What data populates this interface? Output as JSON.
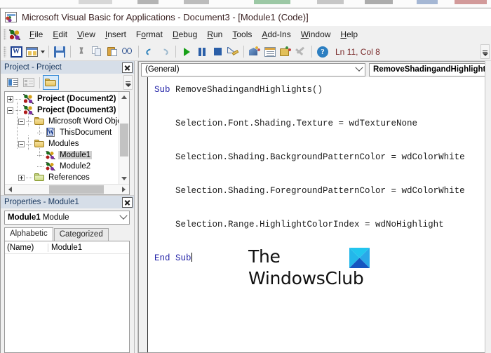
{
  "window": {
    "title": "Microsoft Visual Basic for Applications - Document3 - [Module1 (Code)]",
    "title_icon": "vba-document-icon"
  },
  "menu": {
    "app_icon": "vba-icon",
    "items": [
      {
        "label": "File",
        "accel": "F"
      },
      {
        "label": "Edit",
        "accel": "E"
      },
      {
        "label": "View",
        "accel": "V"
      },
      {
        "label": "Insert",
        "accel": "I"
      },
      {
        "label": "Format",
        "accel": "o"
      },
      {
        "label": "Debug",
        "accel": "D"
      },
      {
        "label": "Run",
        "accel": "R"
      },
      {
        "label": "Tools",
        "accel": "T"
      },
      {
        "label": "Add-Ins",
        "accel": "A"
      },
      {
        "label": "Window",
        "accel": "W"
      },
      {
        "label": "Help",
        "accel": "H"
      }
    ]
  },
  "toolbar": {
    "buttons": [
      {
        "name": "view-word-button",
        "icon": "word-icon"
      },
      {
        "name": "insert-userform-button",
        "icon": "userform-icon"
      },
      {
        "name": "insert-dropdown-button",
        "icon": "chevron-down-icon"
      },
      {
        "name": "save-button",
        "icon": "save-icon"
      },
      {
        "name": "cut-button",
        "icon": "scissors-icon"
      },
      {
        "name": "copy-button",
        "icon": "copy-icon"
      },
      {
        "name": "paste-button",
        "icon": "paste-icon"
      },
      {
        "name": "find-button",
        "icon": "binoculars-icon"
      },
      {
        "name": "undo-button",
        "icon": "undo-arrow-icon"
      },
      {
        "name": "redo-button",
        "icon": "redo-arrow-icon"
      },
      {
        "name": "run-button",
        "icon": "play-triangle-icon"
      },
      {
        "name": "break-button",
        "icon": "pause-icon"
      },
      {
        "name": "reset-button",
        "icon": "stop-square-icon"
      },
      {
        "name": "design-mode-button",
        "icon": "ruler-pencil-icon"
      },
      {
        "name": "project-explorer-button",
        "icon": "project-explorer-icon"
      },
      {
        "name": "properties-window-button",
        "icon": "properties-window-icon"
      },
      {
        "name": "object-browser-button",
        "icon": "object-browser-icon"
      },
      {
        "name": "toolbox-button",
        "icon": "toolbox-icon"
      },
      {
        "name": "help-button",
        "icon": "question-help-icon"
      }
    ],
    "position_indicator": "Ln 11, Col 8",
    "overflow_icon": "toolbar-overflow-icon",
    "word_glyph": "W",
    "help_glyph": "?"
  },
  "project_explorer": {
    "title": "Project - Project",
    "close_icon": "close-icon",
    "toolbar": [
      {
        "name": "view-code-button",
        "icon": "view-code-icon"
      },
      {
        "name": "view-object-button",
        "icon": "view-object-icon"
      },
      {
        "name": "toggle-folders-button",
        "icon": "folder-icon",
        "active": true
      }
    ],
    "overflow_icon": "panel-overflow-icon",
    "tree": [
      {
        "label": "Project (Document2)",
        "icon": "vba-project-icon",
        "indent": 0,
        "expander": "plus",
        "bold": true,
        "selected": false
      },
      {
        "label": "Project (Document3)",
        "icon": "vba-project-icon",
        "indent": 0,
        "expander": "minus",
        "bold": true,
        "selected": false
      },
      {
        "label": "Microsoft Word Obje",
        "icon": "folder-icon",
        "indent": 1,
        "expander": "minus",
        "bold": false,
        "selected": false
      },
      {
        "label": "ThisDocument",
        "icon": "word-document-icon",
        "indent": 2,
        "expander": "none",
        "bold": false,
        "selected": false
      },
      {
        "label": "Modules",
        "icon": "folder-icon",
        "indent": 1,
        "expander": "minus",
        "bold": false,
        "selected": false
      },
      {
        "label": "Module1",
        "icon": "module-icon",
        "indent": 2,
        "expander": "none",
        "bold": false,
        "selected": true
      },
      {
        "label": "Module2",
        "icon": "module-icon",
        "indent": 2,
        "expander": "none",
        "bold": false,
        "selected": false
      },
      {
        "label": "References",
        "icon": "folder-icon-green",
        "indent": 1,
        "expander": "plus",
        "bold": false,
        "selected": false
      }
    ],
    "scroll": {
      "up_icon": "chevron-up-icon",
      "down_icon": "chevron-down-icon",
      "left_icon": "chevron-left-icon",
      "right_icon": "chevron-right-icon"
    }
  },
  "properties": {
    "title": "Properties - Module1",
    "close_icon": "close-icon",
    "object_name": "Module1",
    "object_type": "Module",
    "dropdown_icon": "chevron-down-icon",
    "tabs": [
      {
        "label": "Alphabetic",
        "active": true
      },
      {
        "label": "Categorized",
        "active": false
      }
    ],
    "rows": [
      {
        "key": "(Name)",
        "value": "Module1"
      }
    ]
  },
  "code_window": {
    "object_combo": "(General)",
    "object_combo_icon": "chevron-down-icon",
    "procedure_combo": "RemoveShadingandHighlights",
    "lines": [
      {
        "segments": [
          {
            "t": "Sub",
            "kw": true
          },
          {
            "t": " RemoveShadingandHighlights()",
            "kw": false
          }
        ]
      },
      {
        "segments": []
      },
      {
        "segments": [
          {
            "t": "    Selection.Font.Shading.Texture = wdTextureNone",
            "kw": false
          }
        ]
      },
      {
        "segments": []
      },
      {
        "segments": [
          {
            "t": "    Selection.Shading.BackgroundPatternColor = wdColorWhite",
            "kw": false
          }
        ]
      },
      {
        "segments": []
      },
      {
        "segments": [
          {
            "t": "    Selection.Shading.ForegroundPatternColor = wdColorWhite",
            "kw": false
          }
        ]
      },
      {
        "segments": []
      },
      {
        "segments": [
          {
            "t": "    Selection.Range.HighlightColorIndex = wdNoHighlight",
            "kw": false
          }
        ]
      },
      {
        "segments": []
      },
      {
        "segments": [
          {
            "t": "End Sub",
            "kw": true
          }
        ],
        "caret": true
      }
    ]
  },
  "watermark": {
    "line1": "The",
    "line2": "WindowsClub",
    "logo_icon": "windowsclub-logo-icon",
    "colors": {
      "top": "#22c5ee",
      "left": "#23b7ea",
      "right": "#2aa8e8",
      "bottom": "#1555c0"
    }
  }
}
